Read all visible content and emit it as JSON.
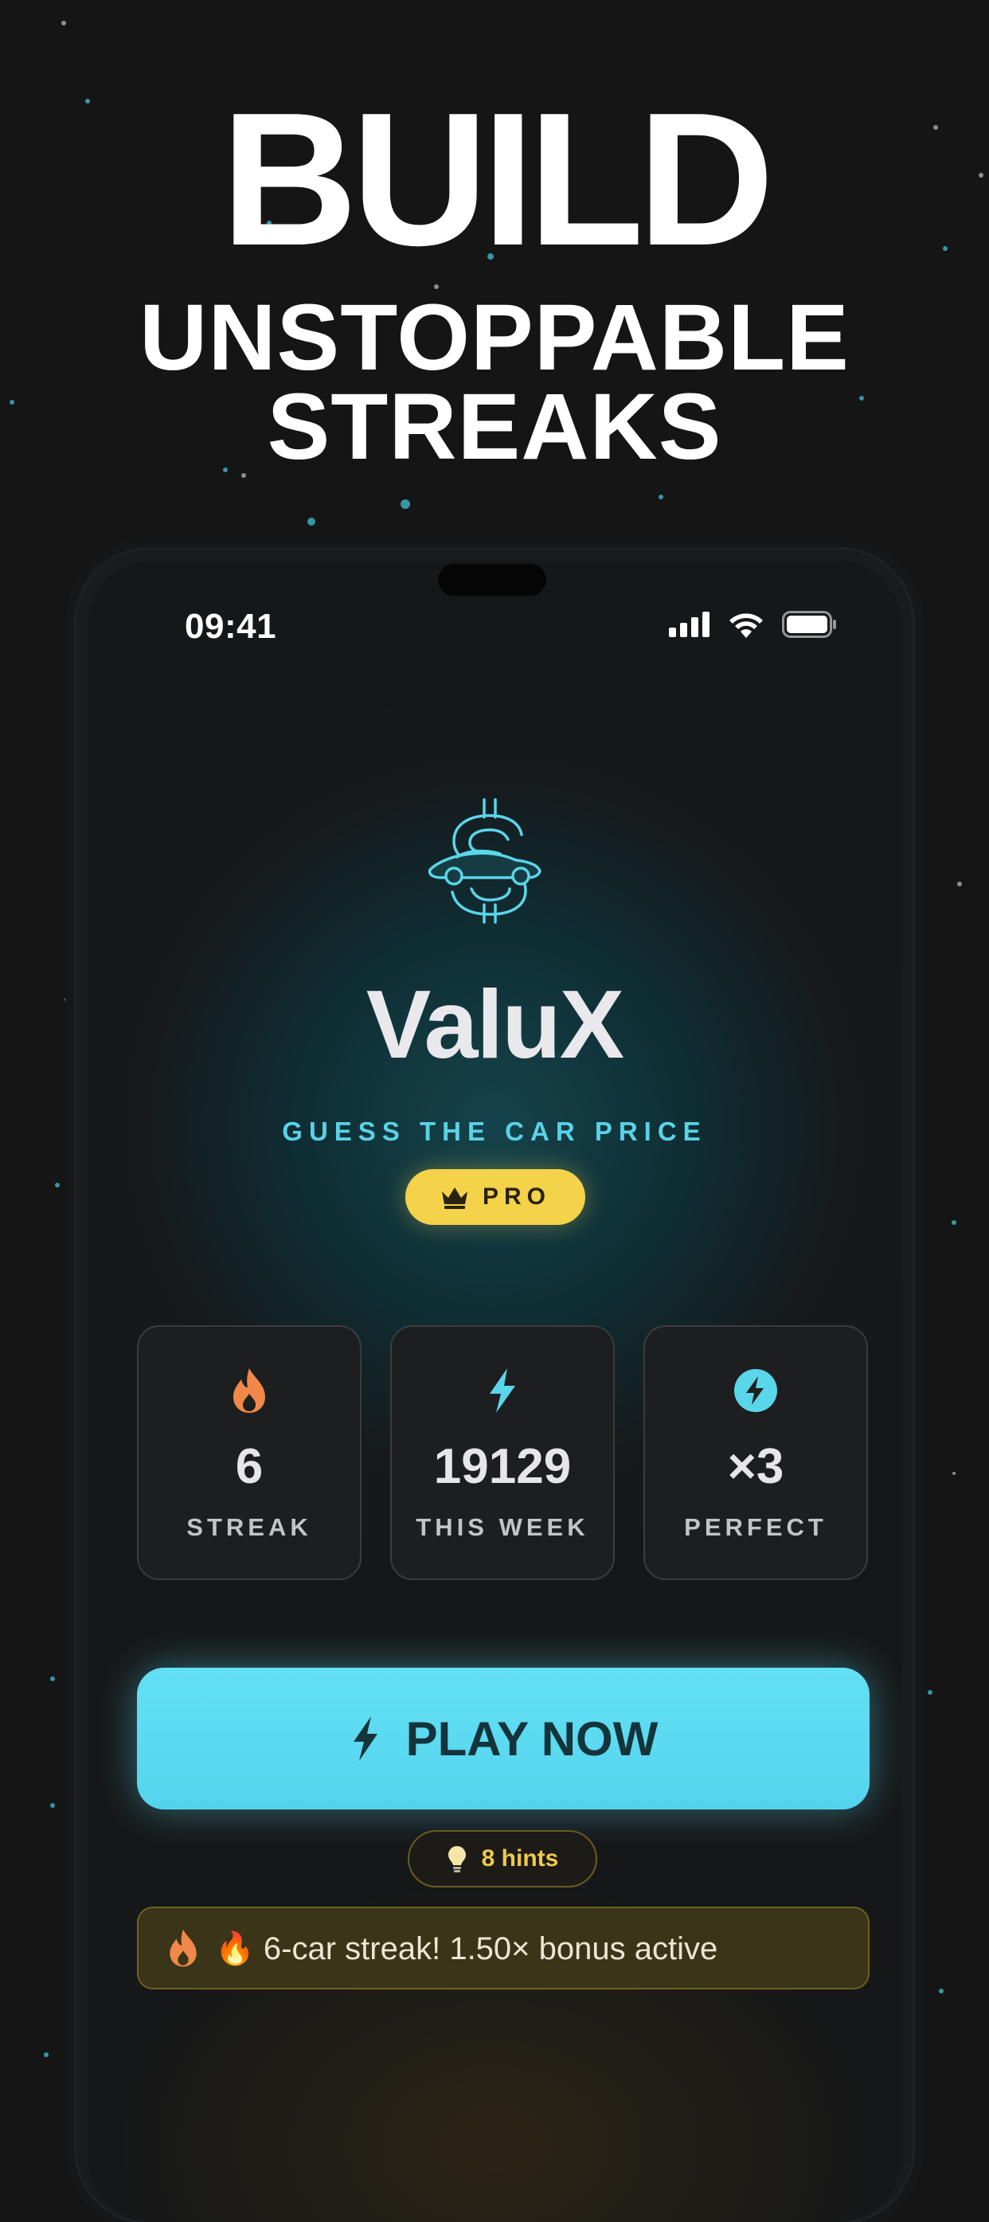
{
  "colors": {
    "background": "#151516",
    "accent_cyan": "#59d2e6",
    "play_button": "#5ad9f0",
    "pro_gold": "#f4d34a",
    "streak_orange": "#f0884a",
    "bonus_bg": "#3a3418"
  },
  "promo": {
    "title": "BUILD",
    "subtitle_line1": "UNSTOPPABLE",
    "subtitle_line2": "STREAKS"
  },
  "status_bar": {
    "time": "09:41",
    "icons": [
      "cellular-signal-icon",
      "wifi-icon",
      "battery-icon"
    ]
  },
  "app": {
    "logo_icon": "dollar-car-icon",
    "name": "ValuX",
    "tagline": "GUESS THE CAR PRICE",
    "badge_icon": "crown-icon",
    "badge_label": "PRO"
  },
  "stats": [
    {
      "icon": "flame-icon",
      "value": "6",
      "label": "STREAK"
    },
    {
      "icon": "lightning-icon",
      "value": "19129",
      "label": "THIS WEEK"
    },
    {
      "icon": "lightning-circle-icon",
      "value": "×3",
      "label": "PERFECT"
    }
  ],
  "play_button": {
    "icon": "lightning-icon",
    "label": "PLAY NOW"
  },
  "hints": {
    "icon": "lightbulb-icon",
    "label": "8 hints"
  },
  "bonus_banner": {
    "icons": [
      "flame-icon",
      "fire-emoji-icon"
    ],
    "text": "🔥 6-car streak! 1.50× bonus active"
  }
}
